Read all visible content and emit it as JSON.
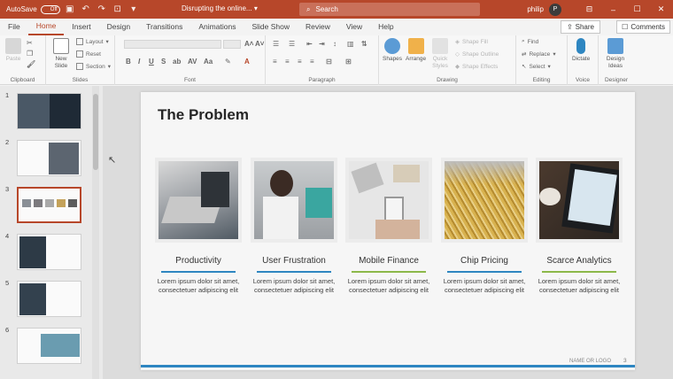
{
  "titlebar": {
    "autosave_label": "AutoSave",
    "autosave_state": "Off",
    "doc_title": "Disrupting the online...",
    "search_placeholder": "Search",
    "username": "philip",
    "avatar_initial": "P"
  },
  "tabs": [
    "File",
    "Home",
    "Insert",
    "Design",
    "Transitions",
    "Animations",
    "Slide Show",
    "Review",
    "View",
    "Help"
  ],
  "share_label": "Share",
  "comments_label": "Comments",
  "ribbon": {
    "clipboard": {
      "paste": "Paste",
      "label": "Clipboard"
    },
    "slides": {
      "new_slide": "New Slide",
      "layout": "Layout",
      "reset": "Reset",
      "section": "Section",
      "label": "Slides"
    },
    "font": {
      "label": "Font"
    },
    "paragraph": {
      "label": "Paragraph"
    },
    "drawing": {
      "shapes": "Shapes",
      "arrange": "Arrange",
      "quick_styles": "Quick Styles",
      "shape_fill": "Shape Fill",
      "shape_outline": "Shape Outline",
      "shape_effects": "Shape Effects",
      "label": "Drawing"
    },
    "editing": {
      "find": "Find",
      "replace": "Replace",
      "select": "Select",
      "label": "Editing"
    },
    "voice": {
      "dictate": "Dictate",
      "label": "Voice"
    },
    "designer": {
      "design_ideas": "Design Ideas",
      "label": "Designer"
    }
  },
  "thumbnails": [
    {
      "num": "1"
    },
    {
      "num": "2"
    },
    {
      "num": "3"
    },
    {
      "num": "4"
    },
    {
      "num": "5"
    },
    {
      "num": "6"
    }
  ],
  "slide": {
    "title": "The Problem",
    "cards": [
      {
        "title": "Productivity",
        "body": "Lorem ipsum dolor sit amet, consectetuer adipiscing elit",
        "line_color": "#2e86c1"
      },
      {
        "title": "User Frustration",
        "body": "Lorem ipsum dolor sit amet, consectetuer adipiscing elit",
        "line_color": "#2e86c1"
      },
      {
        "title": "Mobile Finance",
        "body": "Lorem ipsum dolor sit amet, consectetuer adipiscing elit",
        "line_color": "#8cb84a"
      },
      {
        "title": "Chip Pricing",
        "body": "Lorem ipsum dolor sit amet, consectetuer adipiscing elit",
        "line_color": "#2e86c1"
      },
      {
        "title": "Scarce Analytics",
        "body": "Lorem ipsum dolor sit amet, consectetuer adipiscing elit",
        "line_color": "#8cb84a"
      }
    ],
    "footer_logo": "NAME OR LOGO",
    "slide_number": "3"
  },
  "colors": {
    "accent": "#b7472a",
    "blue": "#2e86c1",
    "green": "#8cb84a"
  }
}
